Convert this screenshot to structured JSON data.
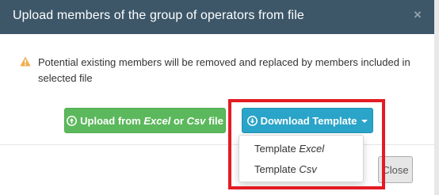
{
  "modal": {
    "title": "Upload members of the group of operators from file",
    "close_symbol": "×"
  },
  "warning": {
    "icon": "warning-triangle-icon",
    "text": "Potential existing members will be removed and replaced by members included in selected file"
  },
  "upload_button": {
    "icon": "arrow-up-circle-icon",
    "prefix": "Upload from ",
    "excel": "Excel",
    "or": " or ",
    "csv": "Csv",
    "suffix": " file"
  },
  "download_button": {
    "icon": "arrow-down-circle-icon",
    "label": "Download Template"
  },
  "dropdown": {
    "items": [
      {
        "prefix": "Template ",
        "format": "Excel"
      },
      {
        "prefix": "Template ",
        "format": "Csv"
      }
    ]
  },
  "footer": {
    "close_label": "Close"
  },
  "colors": {
    "header": "#3d5769",
    "upload_green": "#5cb85c",
    "download_blue": "#2aa4c8",
    "highlight_red": "#e31b23",
    "warning_orange": "#f0ad4e"
  }
}
